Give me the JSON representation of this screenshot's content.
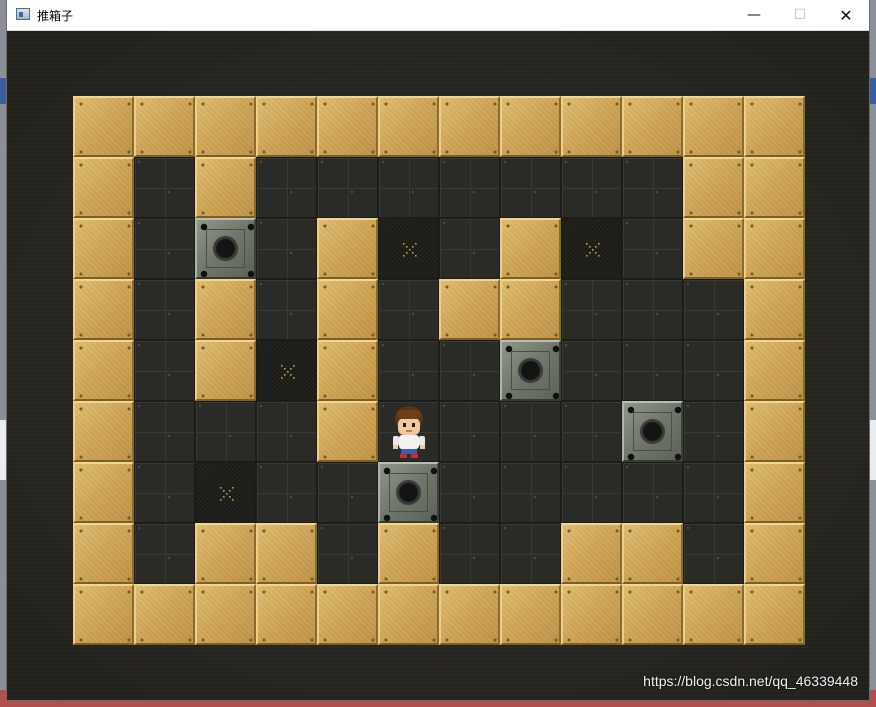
{
  "window": {
    "title": "推箱子",
    "controls": {
      "minimize": "—",
      "maximize": "☐",
      "close": "✕"
    }
  },
  "board": {
    "rows": 9,
    "cols": 12,
    "legend": {
      "W": "wall",
      "F": "floor",
      "T": "target",
      "C": "crate",
      "P": "player"
    },
    "map": [
      "WWWWWWWWWWWW",
      "WFWFFFFFFFWW",
      "WFCFWTFWTFWW",
      "WFWFWFWWFFFW",
      "WFWTWFFCFFFW",
      "WFFFWPFFFCFW",
      "WFTFFCFFFFFW",
      "WFWWFWFFWWFW",
      "WWWWWWWWWWWW"
    ]
  },
  "watermark": "https://blog.csdn.net/qq_46339448"
}
